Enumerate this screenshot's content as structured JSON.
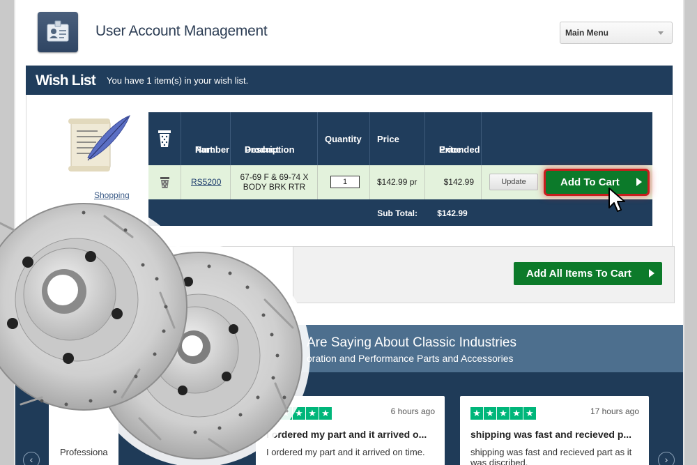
{
  "header": {
    "title": "User Account Management",
    "menu_label": "Main Menu"
  },
  "wishlist": {
    "title": "Wish List",
    "message": "You have 1 item(s) in your wish list.",
    "shopping_link": "Shopping",
    "columns": {
      "part_number": [
        "Part",
        "Number"
      ],
      "description": [
        "Product",
        "Description"
      ],
      "quantity": "Quantity",
      "price": "Price",
      "extended_price": [
        "Extended",
        "Price"
      ]
    },
    "items": [
      {
        "part_number": "RS5200",
        "description": [
          "67-69 F & 69-74 X",
          "BODY BRK RTR"
        ],
        "quantity": "1",
        "price": "$142.99 pr",
        "extended_price": "$142.99",
        "update_label": "Update",
        "add_label": "Add To Cart"
      }
    ],
    "subtotal_label": "Sub Total:",
    "subtotal_value": "$142.99",
    "add_all_label": "Add All Items To Cart"
  },
  "reviews": {
    "title": "Are Saying About Classic Industries",
    "subtitle": "oration and Performance Parts and Accessories",
    "fragment_text": "Professiona",
    "cards": [
      {
        "time": "6 hours ago",
        "headline": "I ordered my part and it arrived o...",
        "body": "I ordered my part and it arrived on time."
      },
      {
        "time": "17 hours ago",
        "headline": "shipping was fast and recieved p...",
        "body": "shipping was fast and recieved part as it was discribed."
      }
    ]
  },
  "colors": {
    "navy": "#203d5c",
    "green_button": "#0c7a2a",
    "highlight_red": "#c81e1e",
    "row_green": "#e3f2dc",
    "trustpilot_green": "#00b67a"
  }
}
